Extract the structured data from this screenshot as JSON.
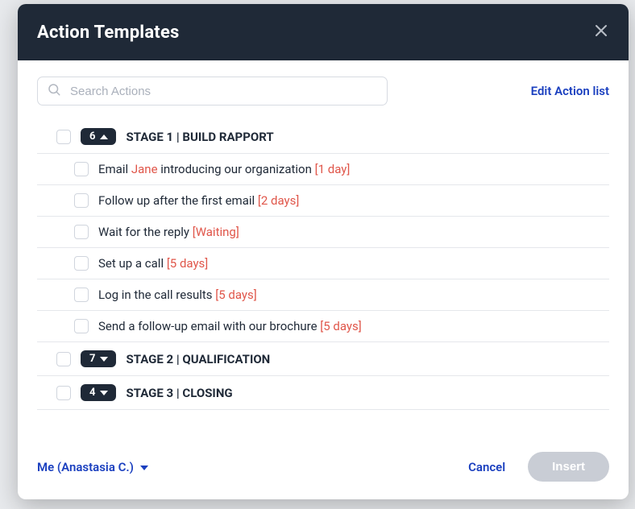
{
  "header": {
    "title": "Action Templates"
  },
  "search": {
    "placeholder": "Search Actions"
  },
  "edit_link": "Edit Action list",
  "stages": [
    {
      "count": "6",
      "label": "STAGE 1 | BUILD RAPPORT",
      "expanded": true,
      "actions": [
        {
          "pre": "Email ",
          "hl1": "Jane",
          "mid": " introducing our organization ",
          "hl2": "[1 day]"
        },
        {
          "pre": "Follow up after the first email ",
          "hl1": "",
          "mid": "",
          "hl2": "[2 days]"
        },
        {
          "pre": "Wait for the reply ",
          "hl1": "",
          "mid": "",
          "hl2": "[Waiting]"
        },
        {
          "pre": "Set up a call ",
          "hl1": "",
          "mid": "",
          "hl2": "[5 days]"
        },
        {
          "pre": "Log in the call results ",
          "hl1": "",
          "mid": "",
          "hl2": "[5 days]"
        },
        {
          "pre": "Send a follow-up email with our brochure ",
          "hl1": "",
          "mid": "",
          "hl2": "[5 days]"
        }
      ]
    },
    {
      "count": "7",
      "label": "STAGE 2 | QUALIFICATION",
      "expanded": false
    },
    {
      "count": "4",
      "label": "STAGE 3 | CLOSING",
      "expanded": false
    }
  ],
  "footer": {
    "assignee": "Me (Anastasia C.)",
    "cancel": "Cancel",
    "insert": "Insert"
  }
}
